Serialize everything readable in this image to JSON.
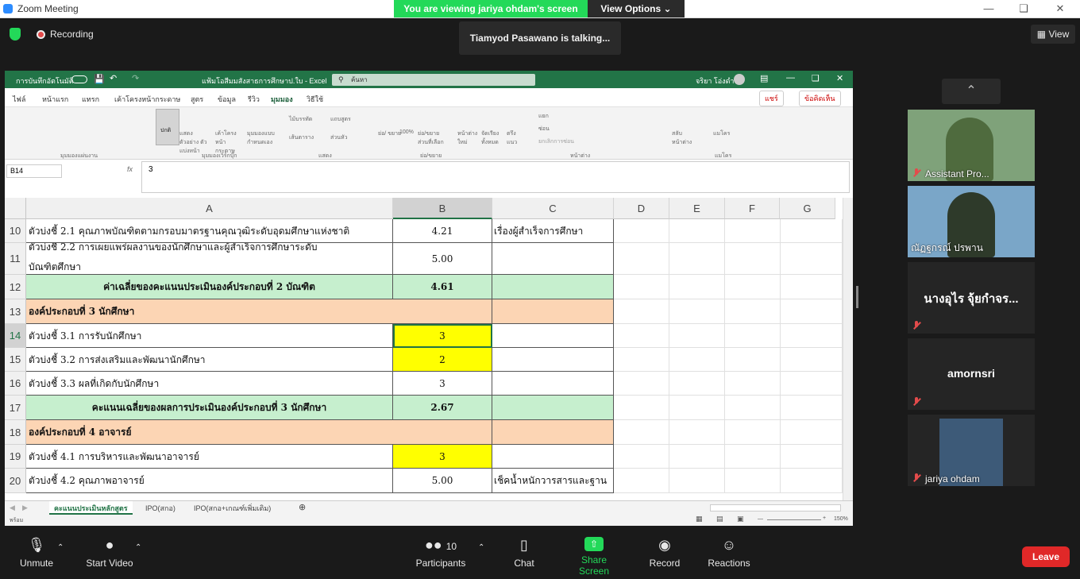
{
  "window": {
    "title": "Zoom Meeting"
  },
  "banner": {
    "viewing": "You are viewing jariya ohdam's screen",
    "view_options": "View Options"
  },
  "top": {
    "recording": "Recording",
    "talking": "Tiamyod Pasawano is talking...",
    "view": "View"
  },
  "excel": {
    "autosave": "การบันทึกอัตโนมัติ",
    "filename": "แฟ้มโอสีมมสังสาธการศึกษาป.ใบ  -  Excel",
    "search_placeholder": "ค้นหา",
    "user": "จริยา โอ่งดำ",
    "tabs": [
      "ไฟล์",
      "หน้าแรก",
      "แทรก",
      "เค้าโครงหน้ากระดาษ",
      "สูตร",
      "ข้อมูล",
      "รีวิว",
      "มุมมอง",
      "วิธีใช้"
    ],
    "active_tab": "มุมมอง",
    "share": "แชร์",
    "comments": "ข้อคิดเห็น",
    "ribbon_groups": [
      "มุมมองแผ่นงาน",
      "มุมมองเวิร์กบุ๊ก",
      "แสดง",
      "ย่อ/ขยาย",
      "หน้าต่าง",
      "แมโคร"
    ],
    "ribbon_buttons": {
      "normal": "ปกติ",
      "page_break": "แสดงตัวอย่าง ตัวแบ่งหน้า",
      "page_layout": "เค้าโครง หน้ากระดาษ",
      "custom_views": "มุมมองแบบ กำหนดเอง",
      "ruler": "ไม้บรรทัด",
      "formula_bar": "แถบสูตร",
      "gridlines": "เส้นตาราง",
      "headings": "ส่วนหัว",
      "zoom": "ย่อ/ ขยาย",
      "zoom100": "100%",
      "zoom_sel": "ย่อ/ขยาย ส่วนที่เลือก",
      "new_window": "หน้าต่าง ใหม่",
      "arrange": "จัดเรียง ทั้งหมด",
      "freeze": "ตรึง แนว",
      "split": "แยก",
      "hide": "ซ่อน",
      "unhide": "ยกเลิกการซ่อน",
      "switch": "สลับ หน้าต่าง",
      "macros": "แมโคร"
    },
    "name_box": "B14",
    "formula": "3",
    "columns": [
      "A",
      "B",
      "C",
      "D",
      "E",
      "F",
      "G"
    ],
    "rows": [
      {
        "num": "10",
        "a": "ตัวบ่งชี้ 2.1 คุณภาพบัณฑิตตามกรอบมาตรฐานคุณวุฒิระดับอุดมศึกษาแห่งชาติ",
        "b": "4.21",
        "c": "เรื่องผู้สำเร็จการศึกษา"
      },
      {
        "num": "11",
        "a": "ตัวบ่งชี้ 2.2 การเผยแพร่ผลงานของนักศึกษาและผู้สำเร็จการศึกษาระดับ",
        "a2": "บัณฑิตศึกษา",
        "b": "5.00",
        "c": ""
      },
      {
        "num": "12",
        "a": "ค่าเฉลี่ยของคะแนนประเมินองค์ประกอบที่ 2 บัณฑิต",
        "b": "4.61",
        "c": ""
      },
      {
        "num": "13",
        "a": "องค์ประกอบที่ 3 นักศึกษา",
        "b": "",
        "c": ""
      },
      {
        "num": "14",
        "a": "ตัวบ่งชี้ 3.1 การรับนักศึกษา",
        "b": "3",
        "c": ""
      },
      {
        "num": "15",
        "a": "ตัวบ่งชี้ 3.2 การส่งเสริมและพัฒนานักศึกษา",
        "b": "2",
        "c": ""
      },
      {
        "num": "16",
        "a": "ตัวบ่งชี้ 3.3 ผลที่เกิดกับนักศึกษา",
        "b": "3",
        "c": ""
      },
      {
        "num": "17",
        "a": "คะแนนเฉลี่ยของผลการประเมินองค์ประกอบที่ 3 นักศึกษา",
        "b": "2.67",
        "c": ""
      },
      {
        "num": "18",
        "a": "องค์ประกอบที่ 4 อาจารย์",
        "b": "",
        "c": ""
      },
      {
        "num": "19",
        "a": "ตัวบ่งชี้ 4.1 การบริหารและพัฒนาอาจารย์",
        "b": "3",
        "c": ""
      },
      {
        "num": "20",
        "a": "ตัวบ่งชี้ 4.2 คุณภาพอาจารย์",
        "b": "5.00",
        "c": "เช็คน้ำหนักวารสารและฐาน"
      }
    ],
    "sheets": [
      "คะแนนประเมินหลักสูตร",
      "IPO(สกอ)",
      "IPO(สกอ+เกณฑ์เพิ่มเติม)"
    ],
    "status": "พร้อม",
    "zoom": "150%"
  },
  "gallery": [
    {
      "name": "Assistant Pro..."
    },
    {
      "name": "ณัฏฐกรณ์ ปรพาน"
    },
    {
      "name": "นางอุไร จุ้ยกำจร..."
    },
    {
      "name": "amornsri"
    },
    {
      "name": "jariya ohdam"
    }
  ],
  "toolbar": {
    "unmute": "Unmute",
    "start_video": "Start Video",
    "participants": "Participants",
    "participants_count": "10",
    "chat": "Chat",
    "share": "Share Screen",
    "record": "Record",
    "reactions": "Reactions",
    "leave": "Leave"
  },
  "colors": {
    "excel_green": "#227447",
    "zoom_green": "#23d959",
    "leave_red": "#e02828",
    "cell_green": "#c6efce",
    "cell_peach": "#fcd5b4",
    "cell_yellow": "#ffff00"
  }
}
